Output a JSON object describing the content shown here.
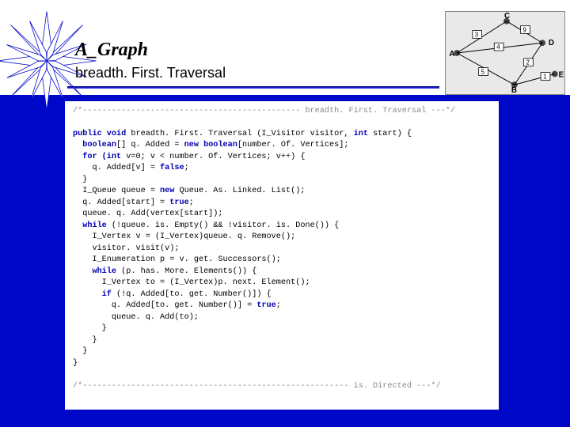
{
  "slide": {
    "title": "A_Graph",
    "subtitle": "breadth. First. Traversal"
  },
  "graph": {
    "nodes": [
      "A",
      "B",
      "C",
      "D",
      "E"
    ],
    "edges": [
      {
        "from": "A",
        "to": "C",
        "weight": "3"
      },
      {
        "from": "A",
        "to": "D",
        "weight": "4"
      },
      {
        "from": "A",
        "to": "B",
        "weight": "5"
      },
      {
        "from": "C",
        "to": "D",
        "weight": "9"
      },
      {
        "from": "B",
        "to": "D",
        "weight": "2"
      },
      {
        "from": "B",
        "to": "E",
        "weight": "1"
      }
    ]
  },
  "code": {
    "commentOpen": "/*--------------------------------------------- breadth. First. Traversal ---*/",
    "sig1": "public void",
    "sig2": " breadth. First. Traversal (I_Visitor visitor, ",
    "sig3": "int",
    "sig4": " start) {",
    "l1a": "  boolean",
    "l1b": "[] q. Added = ",
    "l1c": "new boolean",
    "l1d": "[number. Of. Vertices];",
    "l2a": "  for (int",
    "l2b": " v=0; v < number. Of. Vertices; v++) {",
    "l3a": "    q. Added[v] = ",
    "l3b": "false",
    "l3c": ";",
    "l4": "  }",
    "l5a": "  I_Queue queue = ",
    "l5b": "new",
    "l5c": " Queue. As. Linked. List();",
    "l6a": "  q. Added[start] = ",
    "l6b": "true",
    "l6c": ";",
    "l7": "  queue. q. Add(vertex[start]);",
    "l8a": "  while",
    "l8b": " (!queue. is. Empty() && !visitor. is. Done()) {",
    "l9": "    I_Vertex v = (I_Vertex)queue. q. Remove();",
    "l10": "    visitor. visit(v);",
    "l11": "    I_Enumeration p = v. get. Successors();",
    "l12a": "    while",
    "l12b": " (p. has. More. Elements()) {",
    "l13": "      I_Vertex to = (I_Vertex)p. next. Element();",
    "l14a": "      if",
    "l14b": " (!q. Added[to. get. Number()]) {",
    "l15a": "        q. Added[to. get. Number()] = ",
    "l15b": "true",
    "l15c": ";",
    "l16": "        queue. q. Add(to);",
    "l17": "      }",
    "l18": "    }",
    "l19": "  }",
    "l20": "}",
    "commentClose": "/*------------------------------------------------------- is. Directed ---*/"
  }
}
